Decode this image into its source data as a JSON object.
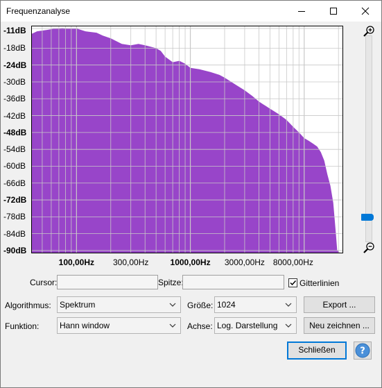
{
  "window": {
    "title": "Frequenzanalyse",
    "buttons": {
      "minimize": "minimize-icon",
      "maximize": "maximize-icon",
      "close": "close-icon"
    }
  },
  "colors": {
    "spectrum_fill": "#9845c9",
    "grid": "#c8c8c8",
    "accent": "#0078d7"
  },
  "chart_data": {
    "type": "area",
    "title": "",
    "xlabel": "",
    "ylabel": "",
    "x_scale": "log",
    "xlim": [
      40,
      22000
    ],
    "ylim": [
      -91,
      -10
    ],
    "grid": true,
    "y_ticks": [
      "-11dB",
      "-18dB",
      "-24dB",
      "-30dB",
      "-36dB",
      "-42dB",
      "-48dB",
      "-54dB",
      "-60dB",
      "-66dB",
      "-72dB",
      "-78dB",
      "-84dB",
      "-90dB"
    ],
    "y_tick_values": [
      -11,
      -18,
      -24,
      -30,
      -36,
      -42,
      -48,
      -54,
      -60,
      -66,
      -72,
      -78,
      -84,
      -90
    ],
    "x_tick_labels": [
      {
        "value": 100,
        "label": "100,00Hz",
        "bold": true
      },
      {
        "value": 300,
        "label": "300,00Hz",
        "bold": false
      },
      {
        "value": 1000,
        "label": "1000,00Hz",
        "bold": true
      },
      {
        "value": 3000,
        "label": "3000,00Hz",
        "bold": false
      },
      {
        "value": 8000,
        "label": "8000,00Hz",
        "bold": false
      }
    ],
    "series": [
      {
        "x": [
          40,
          45,
          55,
          65,
          75,
          85,
          100,
          120,
          150,
          170,
          200,
          250,
          300,
          350,
          400,
          450,
          500,
          550,
          600,
          700,
          800,
          900,
          1000,
          1200,
          1500,
          1800,
          2000,
          2500,
          3000,
          3500,
          4000,
          5000,
          6000,
          7000,
          8000,
          9000,
          10000,
          11000,
          12000,
          13000,
          14000,
          15000,
          16000,
          17000,
          18000,
          19000,
          19500,
          20000,
          20500,
          21000,
          21500,
          22000
        ],
        "y": [
          -13,
          -12,
          -11.5,
          -11,
          -10.8,
          -11,
          -11,
          -12,
          -12.5,
          -13.5,
          -14.5,
          -16.5,
          -17,
          -16.5,
          -17,
          -17.5,
          -18,
          -19,
          -21,
          -23,
          -22.5,
          -23.5,
          -25,
          -25.5,
          -26.5,
          -27.5,
          -28.5,
          -31,
          -33,
          -35,
          -37,
          -39.5,
          -41.5,
          -43.5,
          -46,
          -48,
          -50,
          -51,
          -52,
          -53,
          -55,
          -58,
          -63,
          -67,
          -73,
          -84,
          -90,
          -90,
          -91,
          -91,
          -91,
          -91
        ]
      }
    ]
  },
  "controls": {
    "cursor_label": "Cursor:",
    "peak_label": "Spitze:",
    "cursor_value": "",
    "peak_value": "",
    "grid_label": "Gitterlinien",
    "grid_checked": true,
    "algorithm_label": "Algorithmus:",
    "algorithm_value": "Spektrum",
    "size_label": "Größe:",
    "size_value": "1024",
    "function_label": "Funktion:",
    "function_value": "Hann window",
    "axis_label": "Achse:",
    "axis_value": "Log. Darstellung",
    "export_button": "Export ...",
    "redraw_button": "Neu zeichnen ...",
    "close_button": "Schließen",
    "help_icon": "help-icon"
  },
  "zoom": {
    "zoom_in_icon": "zoom-in-icon",
    "zoom_out_icon": "zoom-out-icon",
    "level": 0.9
  }
}
